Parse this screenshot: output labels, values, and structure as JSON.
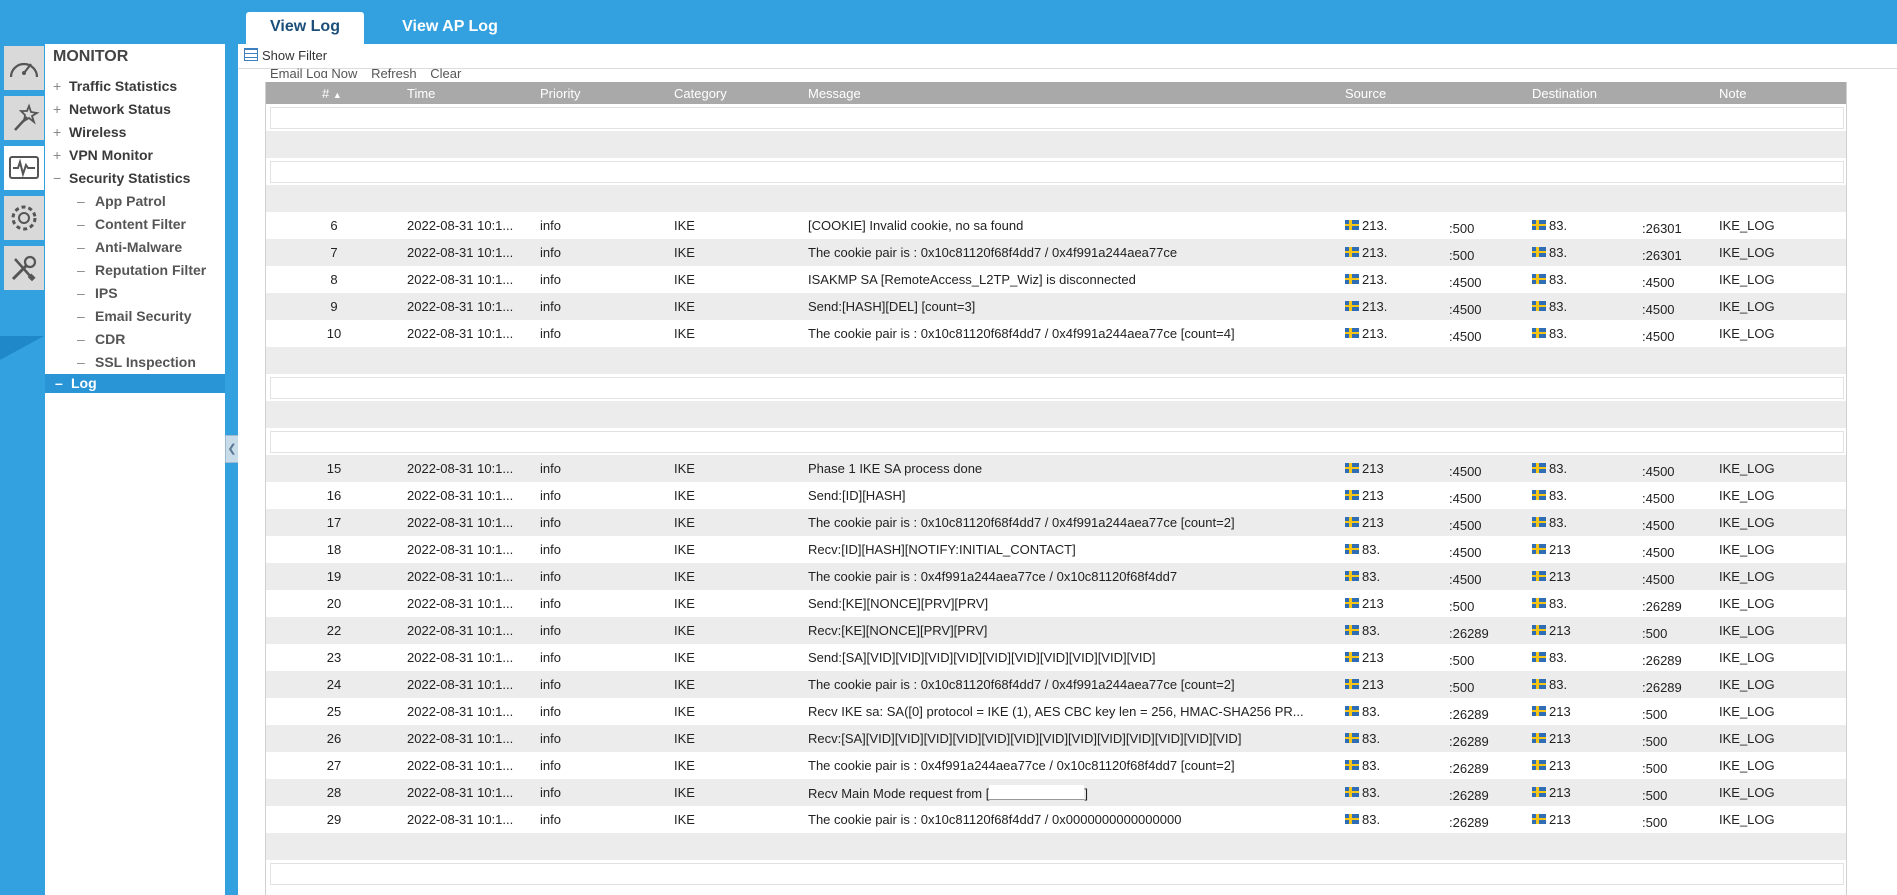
{
  "tabs": [
    "View Log",
    "View AP Log"
  ],
  "nav": {
    "title": "MONITOR",
    "groups": [
      {
        "sign": "+",
        "label": "Traffic Statistics"
      },
      {
        "sign": "+",
        "label": "Network Status"
      },
      {
        "sign": "+",
        "label": "Wireless"
      },
      {
        "sign": "+",
        "label": "VPN Monitor"
      },
      {
        "sign": "−",
        "label": "Security Statistics"
      }
    ],
    "subitems": [
      "App Patrol",
      "Content Filter",
      "Anti-Malware",
      "Reputation Filter",
      "IPS",
      "Email Security",
      "CDR",
      "SSL Inspection"
    ],
    "log_label": "Log"
  },
  "filter_label": "Show Filter",
  "toolbar": [
    "Email Log Now",
    "Refresh",
    "Clear"
  ],
  "columns": [
    "#",
    "Time",
    "Priority",
    "Category",
    "Message",
    "Source",
    "Destination",
    "Note"
  ],
  "rows": [
    {
      "num": "6",
      "time": "2022-08-31 10:1...",
      "priority": "info",
      "category": "IKE",
      "message": "[COOKIE] Invalid cookie, no sa found",
      "src_ip": "213.",
      "src_port": ":500",
      "dst_ip": "83.",
      "dst_port": ":26301",
      "note": "IKE_LOG"
    },
    {
      "num": "7",
      "time": "2022-08-31 10:1...",
      "priority": "info",
      "category": "IKE",
      "message": "The cookie pair is : 0x10c81120f68f4dd7 / 0x4f991a244aea77ce",
      "src_ip": "213.",
      "src_port": ":500",
      "dst_ip": "83.",
      "dst_port": ":26301",
      "note": "IKE_LOG"
    },
    {
      "num": "8",
      "time": "2022-08-31 10:1...",
      "priority": "info",
      "category": "IKE",
      "message": "ISAKMP SA [RemoteAccess_L2TP_Wiz] is disconnected",
      "src_ip": "213.",
      "src_port": ":4500",
      "dst_ip": "83.",
      "dst_port": ":4500",
      "note": "IKE_LOG"
    },
    {
      "num": "9",
      "time": "2022-08-31 10:1...",
      "priority": "info",
      "category": "IKE",
      "message": "Send:[HASH][DEL] [count=3]",
      "src_ip": "213.",
      "src_port": ":4500",
      "dst_ip": "83.",
      "dst_port": ":4500",
      "note": "IKE_LOG"
    },
    {
      "num": "10",
      "time": "2022-08-31 10:1...",
      "priority": "info",
      "category": "IKE",
      "message": "The cookie pair is : 0x10c81120f68f4dd7 / 0x4f991a244aea77ce [count=4]",
      "src_ip": "213.",
      "src_port": ":4500",
      "dst_ip": "83.",
      "dst_port": ":4500",
      "note": "IKE_LOG"
    },
    {
      "num": "15",
      "time": "2022-08-31 10:1...",
      "priority": "info",
      "category": "IKE",
      "message": "Phase 1 IKE SA process done",
      "src_ip": "213",
      "src_port": ":4500",
      "dst_ip": "83.",
      "dst_port": ":4500",
      "note": "IKE_LOG"
    },
    {
      "num": "16",
      "time": "2022-08-31 10:1...",
      "priority": "info",
      "category": "IKE",
      "message": "Send:[ID][HASH]",
      "src_ip": "213",
      "src_port": ":4500",
      "dst_ip": "83.",
      "dst_port": ":4500",
      "note": "IKE_LOG"
    },
    {
      "num": "17",
      "time": "2022-08-31 10:1...",
      "priority": "info",
      "category": "IKE",
      "message": "The cookie pair is : 0x10c81120f68f4dd7 / 0x4f991a244aea77ce [count=2]",
      "src_ip": "213",
      "src_port": ":4500",
      "dst_ip": "83.",
      "dst_port": ":4500",
      "note": "IKE_LOG"
    },
    {
      "num": "18",
      "time": "2022-08-31 10:1...",
      "priority": "info",
      "category": "IKE",
      "message": "Recv:[ID][HASH][NOTIFY:INITIAL_CONTACT]",
      "src_ip": "83.",
      "src_port": ":4500",
      "dst_ip": "213",
      "dst_port": ":4500",
      "note": "IKE_LOG"
    },
    {
      "num": "19",
      "time": "2022-08-31 10:1...",
      "priority": "info",
      "category": "IKE",
      "message": "The cookie pair is : 0x4f991a244aea77ce / 0x10c81120f68f4dd7",
      "src_ip": "83.",
      "src_port": ":4500",
      "dst_ip": "213",
      "dst_port": ":4500",
      "note": "IKE_LOG"
    },
    {
      "num": "20",
      "time": "2022-08-31 10:1...",
      "priority": "info",
      "category": "IKE",
      "message": "Send:[KE][NONCE][PRV][PRV]",
      "src_ip": "213",
      "src_port": ":500",
      "dst_ip": "83.",
      "dst_port": ":26289",
      "note": "IKE_LOG"
    },
    {
      "num": "22",
      "time": "2022-08-31 10:1...",
      "priority": "info",
      "category": "IKE",
      "message": "Recv:[KE][NONCE][PRV][PRV]",
      "src_ip": "83.",
      "src_port": ":26289",
      "dst_ip": "213",
      "dst_port": ":500",
      "note": "IKE_LOG"
    },
    {
      "num": "23",
      "time": "2022-08-31 10:1...",
      "priority": "info",
      "category": "IKE",
      "message": "Send:[SA][VID][VID][VID][VID][VID][VID][VID][VID][VID][VID]",
      "src_ip": "213",
      "src_port": ":500",
      "dst_ip": "83.",
      "dst_port": ":26289",
      "note": "IKE_LOG"
    },
    {
      "num": "24",
      "time": "2022-08-31 10:1...",
      "priority": "info",
      "category": "IKE",
      "message": "The cookie pair is : 0x10c81120f68f4dd7 / 0x4f991a244aea77ce [count=2]",
      "src_ip": "213",
      "src_port": ":500",
      "dst_ip": "83.",
      "dst_port": ":26289",
      "note": "IKE_LOG"
    },
    {
      "num": "25",
      "time": "2022-08-31 10:1...",
      "priority": "info",
      "category": "IKE",
      "message": "Recv IKE sa: SA([0] protocol = IKE (1), AES CBC key len = 256, HMAC-SHA256 PR...",
      "src_ip": "83.",
      "src_port": ":26289",
      "dst_ip": "213",
      "dst_port": ":500",
      "note": "IKE_LOG"
    },
    {
      "num": "26",
      "time": "2022-08-31 10:1...",
      "priority": "info",
      "category": "IKE",
      "message": "Recv:[SA][VID][VID][VID][VID][VID][VID][VID][VID][VID][VID][VID][VID][VID]",
      "src_ip": "83.",
      "src_port": ":26289",
      "dst_ip": "213",
      "dst_port": ":500",
      "note": "IKE_LOG"
    },
    {
      "num": "27",
      "time": "2022-08-31 10:1...",
      "priority": "info",
      "category": "IKE",
      "message": "The cookie pair is : 0x4f991a244aea77ce / 0x10c81120f68f4dd7 [count=2]",
      "src_ip": "83.",
      "src_port": ":26289",
      "dst_ip": "213",
      "dst_port": ":500",
      "note": "IKE_LOG"
    },
    {
      "num": "28",
      "time": "2022-08-31 10:1...",
      "priority": "info",
      "category": "IKE",
      "message": "Recv Main Mode request from [",
      "message_suffix": "]",
      "src_ip": "83.",
      "src_port": ":26289",
      "dst_ip": "213",
      "dst_port": ":500",
      "note": "IKE_LOG"
    },
    {
      "num": "29",
      "time": "2022-08-31 10:1...",
      "priority": "info",
      "category": "IKE",
      "message": "The cookie pair is : 0x10c81120f68f4dd7 / 0x0000000000000000",
      "src_ip": "83.",
      "src_port": ":26289",
      "dst_ip": "213",
      "dst_port": ":500",
      "note": "IKE_LOG"
    }
  ],
  "colors": {
    "brand_blue": "#33a1e0",
    "header_gray": "#a9a9a9",
    "row_shade": "#ececec",
    "nav_active": "#2a95d6"
  },
  "icons": [
    "gauge-icon",
    "wand-icon",
    "monitor-pulse-icon",
    "gear-icon",
    "tools-icon"
  ]
}
